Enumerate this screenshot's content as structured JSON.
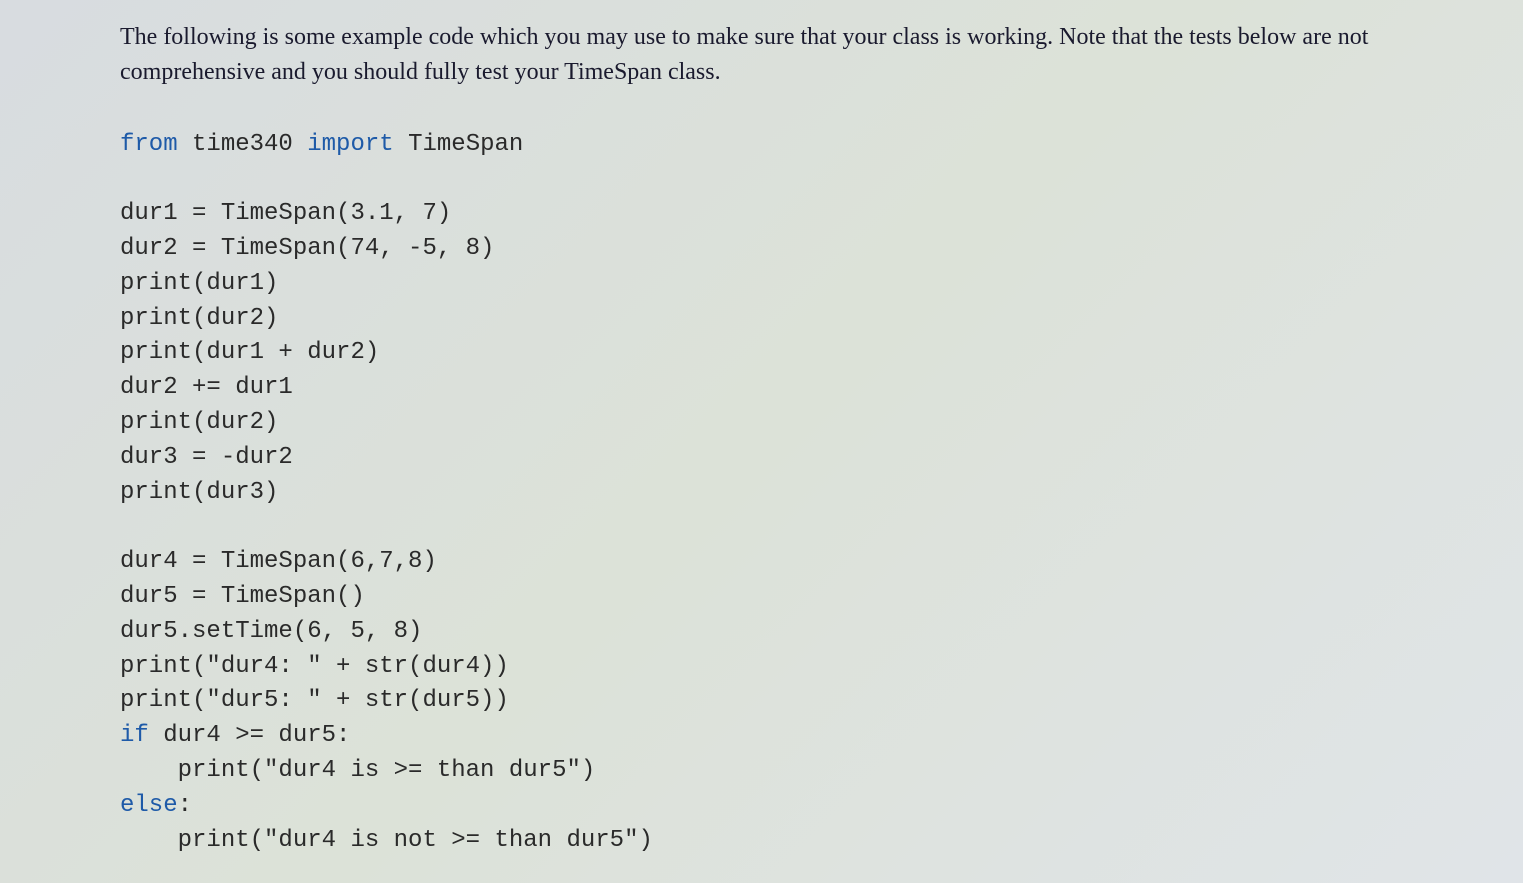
{
  "intro": {
    "line1": "The following is some example code which you may use to make sure that your class is working.",
    "line2": "Note that the tests below are not comprehensive and you should fully test your TimeSpan class."
  },
  "code": {
    "import_from": "from",
    "import_module": "time340",
    "import_kw": "import",
    "import_name": "TimeSpan",
    "line_dur1": "dur1 = TimeSpan(3.1, 7)",
    "line_dur2": "dur2 = TimeSpan(74, -5, 8)",
    "line_print_dur1": "print(dur1)",
    "line_print_dur2": "print(dur2)",
    "line_print_sum": "print(dur1 + dur2)",
    "line_iadd": "dur2 += dur1",
    "line_print_dur2b": "print(dur2)",
    "line_dur3": "dur3 = -dur2",
    "line_print_dur3": "print(dur3)",
    "line_dur4": "dur4 = TimeSpan(6,7,8)",
    "line_dur5": "dur5 = TimeSpan()",
    "line_settime": "dur5.setTime(6, 5, 8)",
    "line_print_dur4": "print(\"dur4: \" + str(dur4))",
    "line_print_dur5": "print(\"dur5: \" + str(dur5))",
    "kw_if": "if",
    "if_cond": " dur4 >= dur5:",
    "line_if_body": "    print(\"dur4 is >= than dur5\")",
    "kw_else": "else",
    "else_colon": ":",
    "line_else_body": "    print(\"dur4 is not >= than dur5\")"
  }
}
